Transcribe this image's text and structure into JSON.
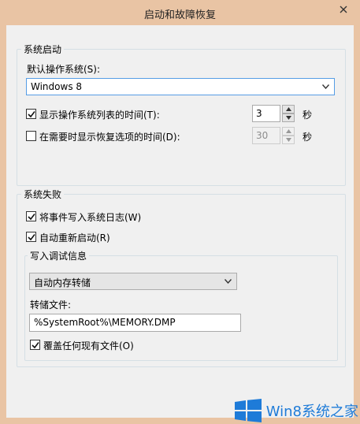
{
  "window": {
    "title": "启动和故障恢复"
  },
  "startup": {
    "group_label": "系统启动",
    "default_os_label": "默认操作系统(S):",
    "default_os_value": "Windows 8",
    "show_list_label": "显示操作系统列表的时间(T):",
    "show_list_checked": true,
    "show_list_value": "3",
    "show_list_unit": "秒",
    "show_recovery_label": "在需要时显示恢复选项的时间(D):",
    "show_recovery_checked": false,
    "show_recovery_value": "30",
    "show_recovery_unit": "秒"
  },
  "failure": {
    "group_label": "系统失败",
    "write_log_label": "将事件写入系统日志(W)",
    "write_log_checked": true,
    "auto_restart_label": "自动重新启动(R)",
    "auto_restart_checked": true,
    "debug": {
      "group_label": "写入调试信息",
      "dump_type_value": "自动内存转储",
      "dump_file_label": "转储文件:",
      "dump_file_value": "%SystemRoot%\\MEMORY.DMP",
      "overwrite_label": "覆盖任何现有文件(O)",
      "overwrite_checked": true
    }
  },
  "watermark": {
    "text": "Win8系统之家",
    "icon": "windows-logo-icon"
  },
  "colors": {
    "frame": "#e9c4a4",
    "client": "#f0f0f0",
    "accent": "#1e7bd8"
  }
}
